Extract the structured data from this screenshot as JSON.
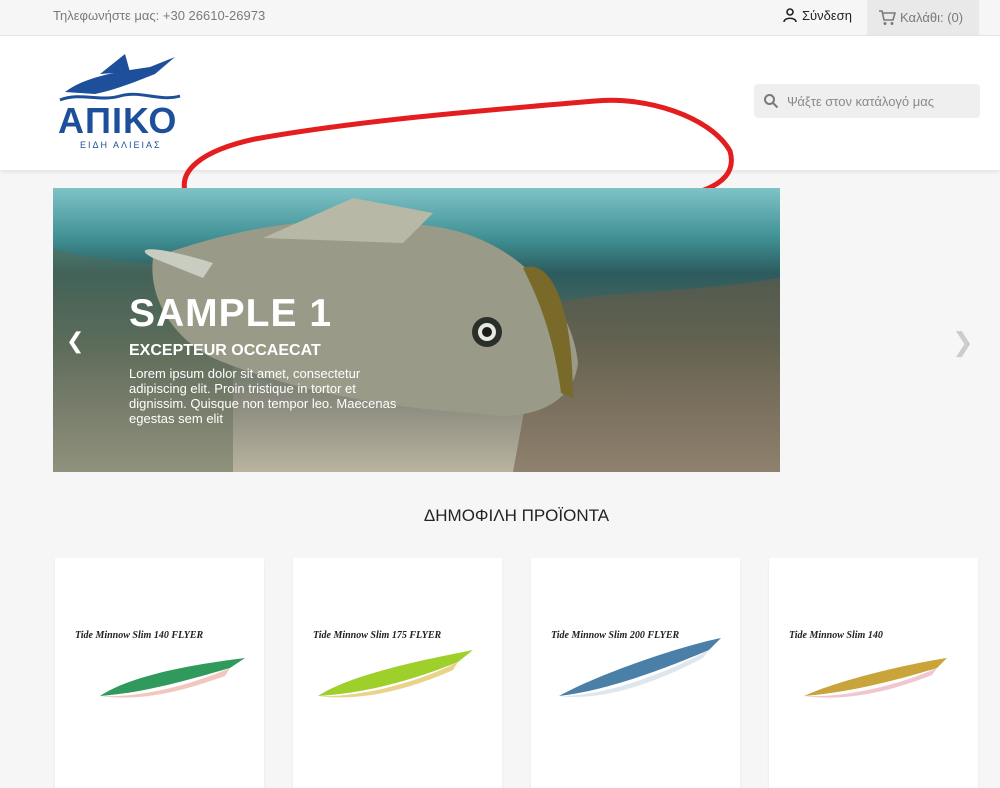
{
  "topbar": {
    "contact": "Τηλεφωνήστε μας: +30 26610-26973",
    "signin": "Σύνδεση",
    "cart": "Καλάθι: (0)"
  },
  "header": {
    "logo_brand": "ΑΠΙΚΟ",
    "logo_sub": "ΕΙΔΗ ΑΛΙΕΙΑΣ",
    "search_placeholder": "Ψάξτε στον κατάλογό μας"
  },
  "carousel": {
    "title": "SAMPLE 1",
    "subtitle": "EXCEPTEUR OCCAECAT",
    "text": "Lorem ipsum dolor sit amet, consectetur adipiscing elit. Proin tristique in tortor et dignissim. Quisque non tempor leo. Maecenas egestas sem elit"
  },
  "section": {
    "title": "ΔΗΜΟΦΙΛΗ ΠΡΟΪΟΝΤΑ"
  },
  "products": [
    {
      "label": "Tide Minnow Slim 140 FLYER",
      "body": "#2f9a5b",
      "belly": "#f0c8c0"
    },
    {
      "label": "Tide Minnow Slim 175 FLYER",
      "body": "#9fcf2a",
      "belly": "#e9d28a"
    },
    {
      "label": "Tide Minnow Slim 200 FLYER",
      "body": "#4a7fa8",
      "belly": "#dfe7ee"
    },
    {
      "label": "Tide Minnow Slim 140",
      "body": "#c9a43a",
      "belly": "#f1c6cf"
    }
  ],
  "colors": {
    "brand": "#1d4f9a",
    "annotation": "#e41e1e"
  }
}
